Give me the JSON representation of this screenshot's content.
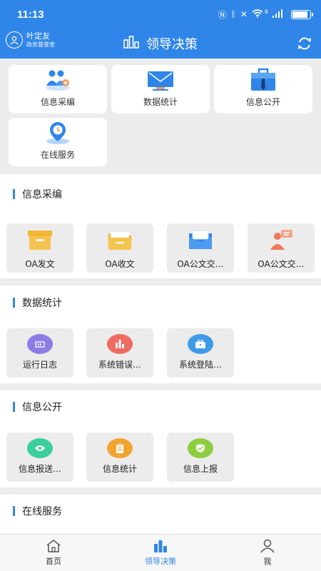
{
  "status": {
    "time": "11:13",
    "wifi_speed": "6"
  },
  "header": {
    "user_name": "叶定友",
    "user_dept": "政务督查室",
    "title": "领导决策"
  },
  "top_tiles": [
    {
      "label": "信息采编",
      "icon": "people-gear-icon"
    },
    {
      "label": "数据统计",
      "icon": "envelope-monitor-icon"
    },
    {
      "label": "信息公开",
      "icon": "briefcase-icon"
    },
    {
      "label": "在线服务",
      "icon": "location-clock-icon"
    }
  ],
  "sections": [
    {
      "title": "信息采编",
      "items": [
        {
          "label": "OA发文",
          "icon": "folder-box-icon"
        },
        {
          "label": "OA收文",
          "icon": "open-folder-icon"
        },
        {
          "label": "OA公文交…",
          "icon": "blue-folder-icon"
        },
        {
          "label": "OA公文交…",
          "icon": "person-chat-icon"
        }
      ]
    },
    {
      "title": "数据统计",
      "items": [
        {
          "label": "运行日志",
          "icon": "log-icon",
          "color": "#8e7be6"
        },
        {
          "label": "系统错误…",
          "icon": "bar-chart-icon",
          "color": "#ef6b62"
        },
        {
          "label": "系统登陆…",
          "icon": "briefcase-icon",
          "color": "#3f9ae8"
        }
      ]
    },
    {
      "title": "信息公开",
      "items": [
        {
          "label": "信息报送…",
          "icon": "eye-icon",
          "color": "#3ccf9e"
        },
        {
          "label": "信息统计",
          "icon": "clipboard-icon",
          "color": "#f2a431"
        },
        {
          "label": "信息上报",
          "icon": "shield-check-icon",
          "color": "#8cce3f"
        }
      ]
    },
    {
      "title": "在线服务",
      "items": []
    }
  ],
  "tabs": [
    {
      "label": "首页",
      "icon": "home-icon"
    },
    {
      "label": "领导决策",
      "icon": "bar-chart-icon",
      "active": true
    },
    {
      "label": "我",
      "icon": "person-icon"
    }
  ]
}
